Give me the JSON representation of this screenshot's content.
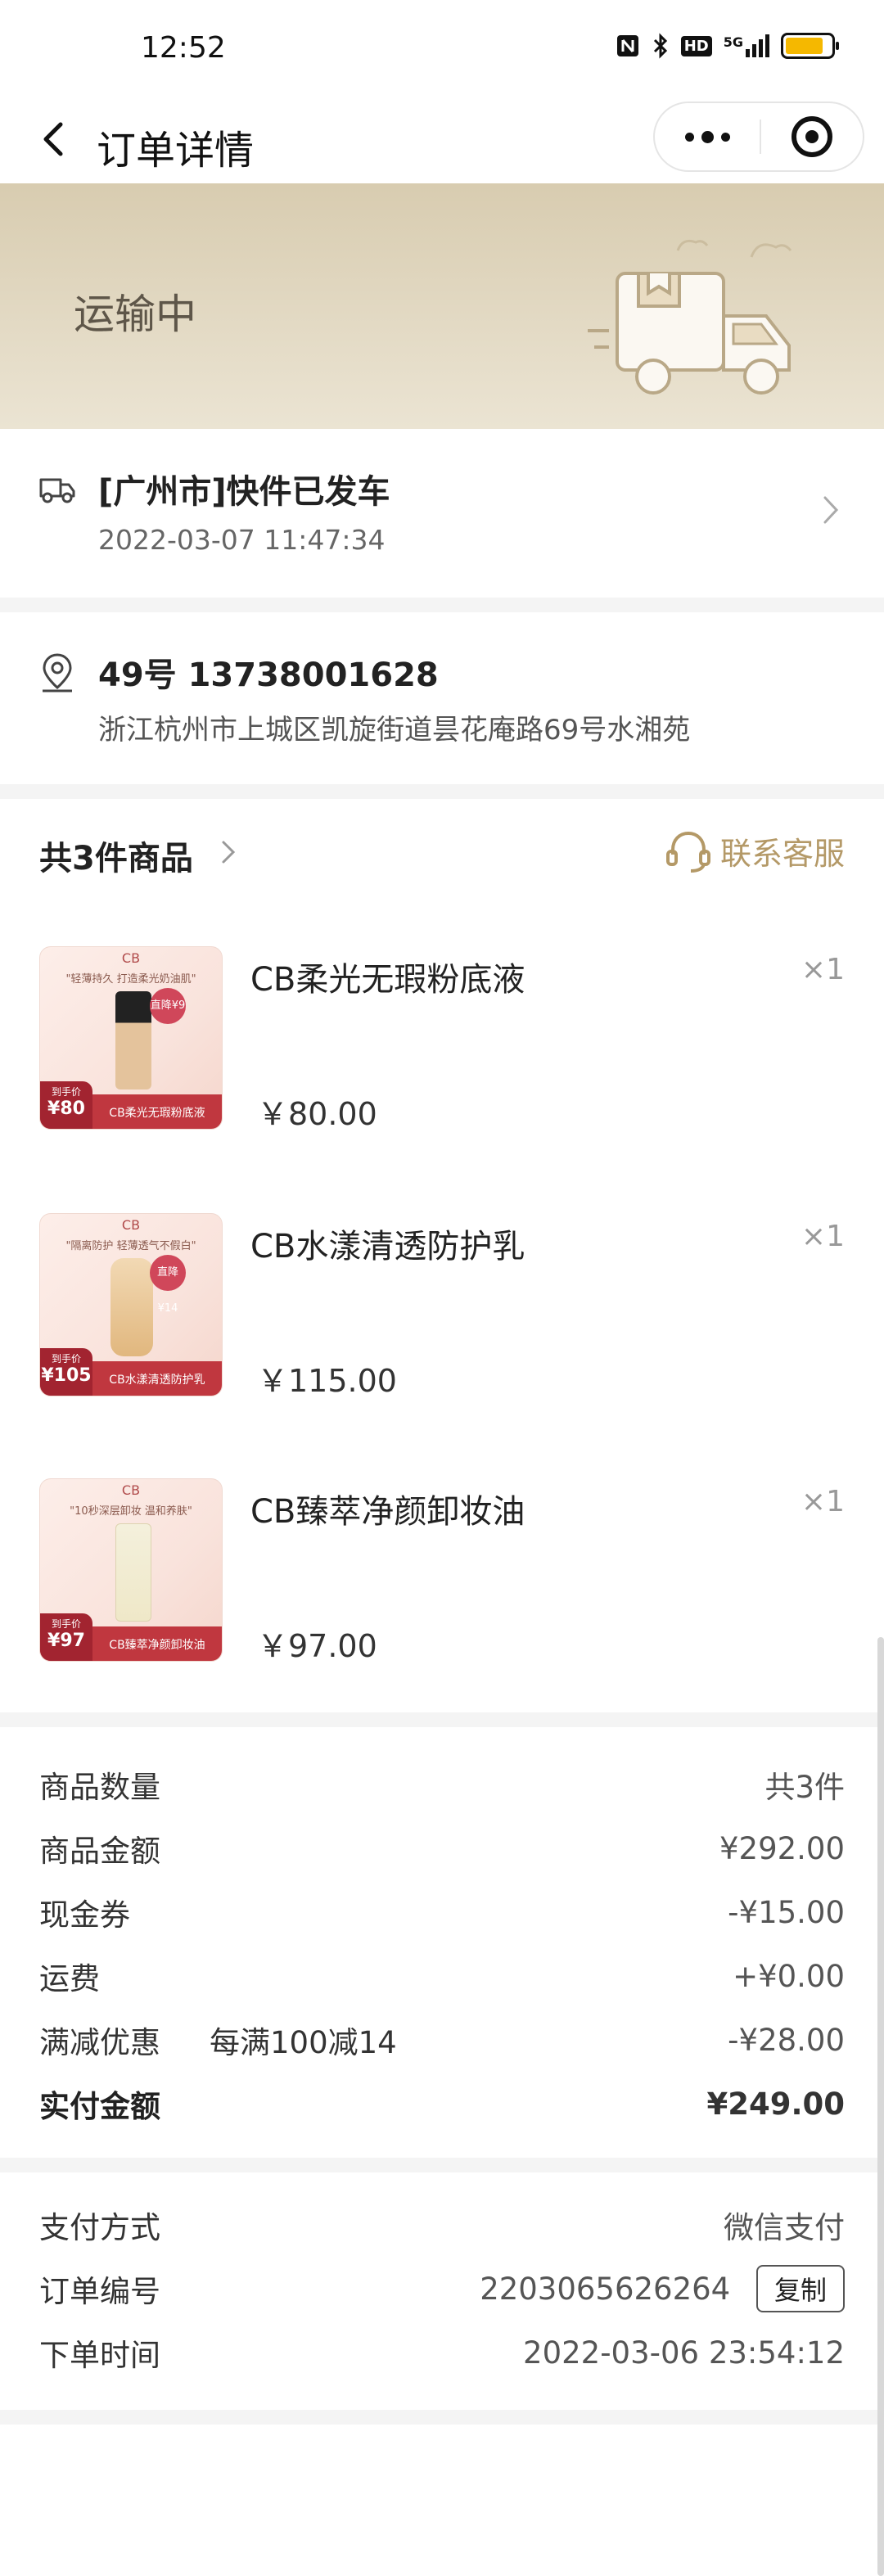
{
  "status_bar": {
    "time": "12:52",
    "icons": [
      "nfc-icon",
      "bluetooth-icon",
      "hd-icon",
      "5g-signal-icon",
      "battery-icon"
    ],
    "hd_label": "HD",
    "network_label": "5G"
  },
  "nav": {
    "title": "订单详情"
  },
  "banner": {
    "status": "运输中"
  },
  "logistics": {
    "title": "[广州市]快件已发车",
    "time": "2022-03-07 11:47:34"
  },
  "address": {
    "name_phone": "49号 13738001628",
    "line": "浙江杭州市上城区凯旋街道昙花庵路69号水湘苑"
  },
  "products": {
    "header": "共3件商品",
    "service_label": "联系客服",
    "items": [
      {
        "name": "CB柔光无瑕粉底液",
        "qty": "×1",
        "price": "￥80.00",
        "thumb_brand": "CB",
        "thumb_tagline": "\"轻薄持久 打造柔光奶油肌\"",
        "thumb_badge": "直降¥9",
        "thumb_price_label": "到手价",
        "thumb_price": "¥80",
        "thumb_name": "CB柔光无瑕粉底液"
      },
      {
        "name": "CB水漾清透防护乳",
        "qty": "×1",
        "price": "￥115.00",
        "thumb_brand": "CB",
        "thumb_tagline": "\"隔离防护 轻薄透气不假白\"",
        "thumb_badge": "直降¥14",
        "thumb_price_label": "到手价",
        "thumb_price": "¥105",
        "thumb_name": "CB水漾清透防护乳"
      },
      {
        "name": "CB臻萃净颜卸妆油",
        "qty": "×1",
        "price": "￥97.00",
        "thumb_brand": "CB",
        "thumb_tagline": "\"10秒深层卸妆 温和养肤\"",
        "thumb_badge": "",
        "thumb_price_label": "到手价",
        "thumb_price": "¥97",
        "thumb_name": "CB臻萃净颜卸妆油"
      }
    ]
  },
  "summary": {
    "rows": [
      {
        "label": "商品数量",
        "value": "共3件"
      },
      {
        "label": "商品金额",
        "value": "¥292.00"
      },
      {
        "label": "现金券",
        "value": "-¥15.00"
      },
      {
        "label": "运费",
        "value": "+¥0.00"
      },
      {
        "label": "满减优惠",
        "extra": "每满100减14",
        "value": "-¥28.00"
      }
    ],
    "total_label": "实付金额",
    "total_value": "¥249.00"
  },
  "order_info": {
    "payment_label": "支付方式",
    "payment_value": "微信支付",
    "order_no_label": "订单编号",
    "order_no_value": "2203065626264",
    "copy_label": "复制",
    "order_time_label": "下单时间",
    "order_time_value": "2022-03-06 23:54:12"
  },
  "colors": {
    "banner_bg": "#d8ccb0",
    "accent_gold": "#b49967",
    "thumb_red": "#c0373f"
  }
}
